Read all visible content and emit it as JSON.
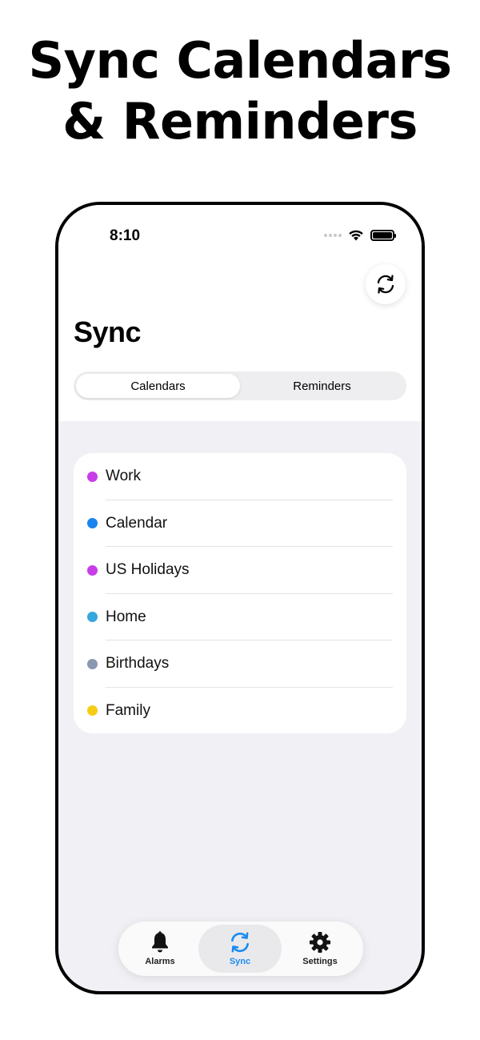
{
  "headline": {
    "line1": "Sync Calendars",
    "line2": "& Reminders"
  },
  "status_bar": {
    "time": "8:10"
  },
  "page": {
    "title": "Sync"
  },
  "segmented_control": {
    "options": [
      "Calendars",
      "Reminders"
    ],
    "selected": "Calendars"
  },
  "calendars": [
    {
      "name": "Work",
      "color": "#c73ee6"
    },
    {
      "name": "Calendar",
      "color": "#1a84f0"
    },
    {
      "name": "US Holidays",
      "color": "#c73ee6"
    },
    {
      "name": "Home",
      "color": "#35a7dc"
    },
    {
      "name": "Birthdays",
      "color": "#8a97b0"
    },
    {
      "name": "Family",
      "color": "#f7cc15"
    }
  ],
  "tab_bar": {
    "items": [
      {
        "label": "Alarms",
        "icon": "bell-icon"
      },
      {
        "label": "Sync",
        "icon": "sync-icon"
      },
      {
        "label": "Settings",
        "icon": "gear-icon"
      }
    ],
    "selected": "Sync"
  },
  "colors": {
    "accent": "#1a8cf0",
    "background": "#f1f1f5"
  }
}
